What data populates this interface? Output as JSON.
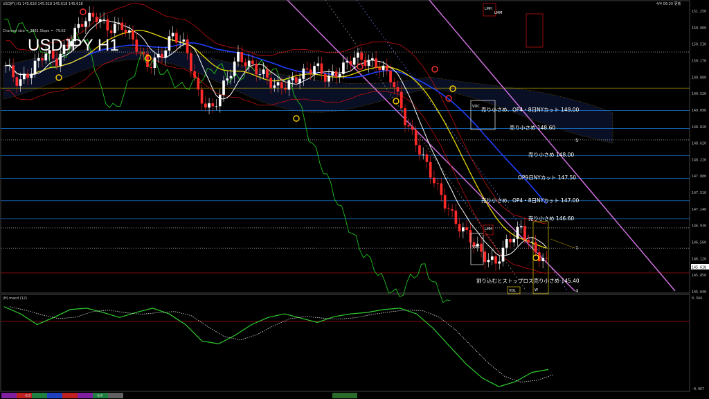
{
  "header": {
    "info_line": "USDJPY,H1  145.618 145.618 145.618 145.618",
    "timestamp": "4/4 06:30 更新",
    "channel_line": "Channel size = 3881 Slope = -79.62",
    "big_title": "USDJPY H1"
  },
  "price_axis": {
    "current_price": "145.618",
    "ticks": [
      "151.250",
      "150.900",
      "150.530",
      "150.170",
      "149.800",
      "149.520",
      "149.090",
      "148.820",
      "148.620",
      "148.220",
      "147.880",
      "147.510",
      "147.140",
      "146.930",
      "146.560",
      "146.120",
      "145.850",
      "145.040"
    ]
  },
  "annotations": [
    {
      "id": "a1",
      "text": "売り小さめ、OP4・8日NYカット 149.00"
    },
    {
      "id": "a2",
      "text": "売り小さめ 148.60"
    },
    {
      "id": "a3",
      "text": "売り小さめ 148.00"
    },
    {
      "id": "a4",
      "text": "OP9日NYカット 147.50"
    },
    {
      "id": "a5",
      "text": "売り小さめ、OP4・8日NYカット 147.00"
    },
    {
      "id": "a6",
      "text": "売り小さめ 146.60"
    },
    {
      "id": "a7",
      "text": "割り込むとストップロス売り小さめ 145.40"
    }
  ],
  "wave_labels": [
    "1",
    "4",
    "5"
  ],
  "box_tags": [
    "VDC",
    "VDC",
    "VDL",
    "LMH",
    "LMH",
    "LMM",
    "W"
  ],
  "macd": {
    "label": "(H) macd (12)",
    "top_value": "0.344",
    "bottom_value": "-0.967"
  },
  "date_bar": {
    "labels": [
      "4/3",
      "4/4"
    ]
  },
  "colors": {
    "up_candle": "#ffffff",
    "down_candle": "#ff2a2a",
    "channel": "#d070e0",
    "sma_white": "#ffffff",
    "sma_yellow": "#e8d800",
    "sma_blue": "#2040ff",
    "bollinger": "#c01010",
    "lagging": "#20c020",
    "macd_main": "#30d030",
    "macd_signal": "#e06090"
  },
  "chart_data": {
    "type": "line",
    "title": "USDJPY H1",
    "series": [
      {
        "name": "price",
        "values": [
          150.0,
          149.6,
          149.9,
          150.3,
          150.1,
          150.6,
          151.0,
          151.1,
          150.8,
          150.9,
          150.5,
          150.0,
          150.2,
          150.7,
          150.4,
          149.3,
          149.0,
          149.6,
          150.2,
          150.0,
          149.8,
          149.5,
          149.6,
          149.8,
          150.0,
          149.7,
          149.9,
          150.2,
          150.1,
          150.0,
          149.7,
          148.8,
          148.2,
          147.6,
          147.0,
          146.5,
          146.2,
          145.8,
          145.6,
          146.1,
          146.4,
          145.9,
          145.62
        ]
      },
      {
        "name": "macd",
        "values": [
          0.2,
          0.1,
          -0.05,
          0.05,
          0.16,
          0.18,
          0.12,
          0.05,
          0.12,
          0.18,
          0.1,
          -0.05,
          -0.28,
          -0.32,
          -0.2,
          -0.05,
          0.05,
          0.1,
          0.04,
          -0.02,
          0.06,
          0.1,
          0.12,
          0.16,
          0.18,
          0.1,
          -0.1,
          -0.35,
          -0.6,
          -0.8,
          -0.92,
          -0.85,
          -0.72,
          -0.68
        ]
      }
    ],
    "ylim": [
      145.0,
      151.3
    ]
  }
}
